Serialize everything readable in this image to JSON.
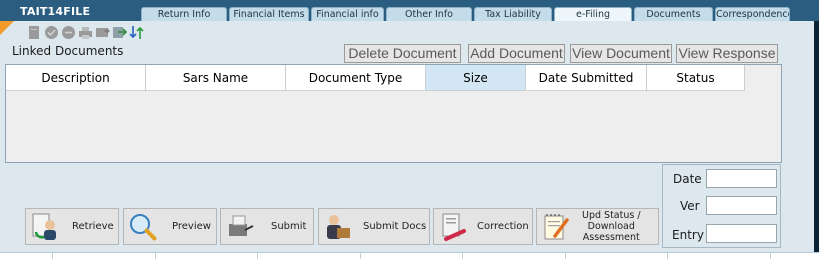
{
  "app": {
    "title": "TAIT14FILE"
  },
  "tabs": [
    {
      "label": "Return Info",
      "active": false
    },
    {
      "label": "Financial Items",
      "active": false
    },
    {
      "label": "Financial info",
      "active": false
    },
    {
      "label": "Other Info",
      "active": false
    },
    {
      "label": "Tax Liability",
      "active": false
    },
    {
      "label": "e-Filing",
      "active": true
    },
    {
      "label": "Documents",
      "active": false
    },
    {
      "label": "Correspondence",
      "active": false
    }
  ],
  "toolbar": {
    "icons": [
      "new-document-icon",
      "approve-icon",
      "cancel-icon",
      "print-icon",
      "export-icon",
      "transfer-icon",
      "sort-icon"
    ]
  },
  "linked_documents": {
    "title": "Linked Documents",
    "buttons": {
      "delete": "Delete Document",
      "add": "Add Document",
      "view": "View Document",
      "view_response": "View Response"
    },
    "columns": [
      "Description",
      "Sars Name",
      "Document Type",
      "Size",
      "Date Submitted",
      "Status"
    ],
    "sorted_column": "Size",
    "rows": []
  },
  "info_panel": {
    "date_label": "Date",
    "ver_label": "Ver",
    "entry_label": "Entry",
    "date_value": "",
    "ver_value": "",
    "entry_value": ""
  },
  "actions": {
    "retrieve": "Retrieve",
    "preview": "Preview",
    "submit": "Submit",
    "submit_docs": "Submit Docs",
    "correction": "Correction",
    "upd_status_1": "Upd Status /",
    "upd_status_2": "Download",
    "upd_status_3": "Assessment"
  },
  "colors": {
    "top_bar": "#2b5d80",
    "background": "#dce8ee",
    "accent_corner": "#f29a2a",
    "tab": "#c4dcea",
    "sorted_header": "#d3e6f4"
  }
}
